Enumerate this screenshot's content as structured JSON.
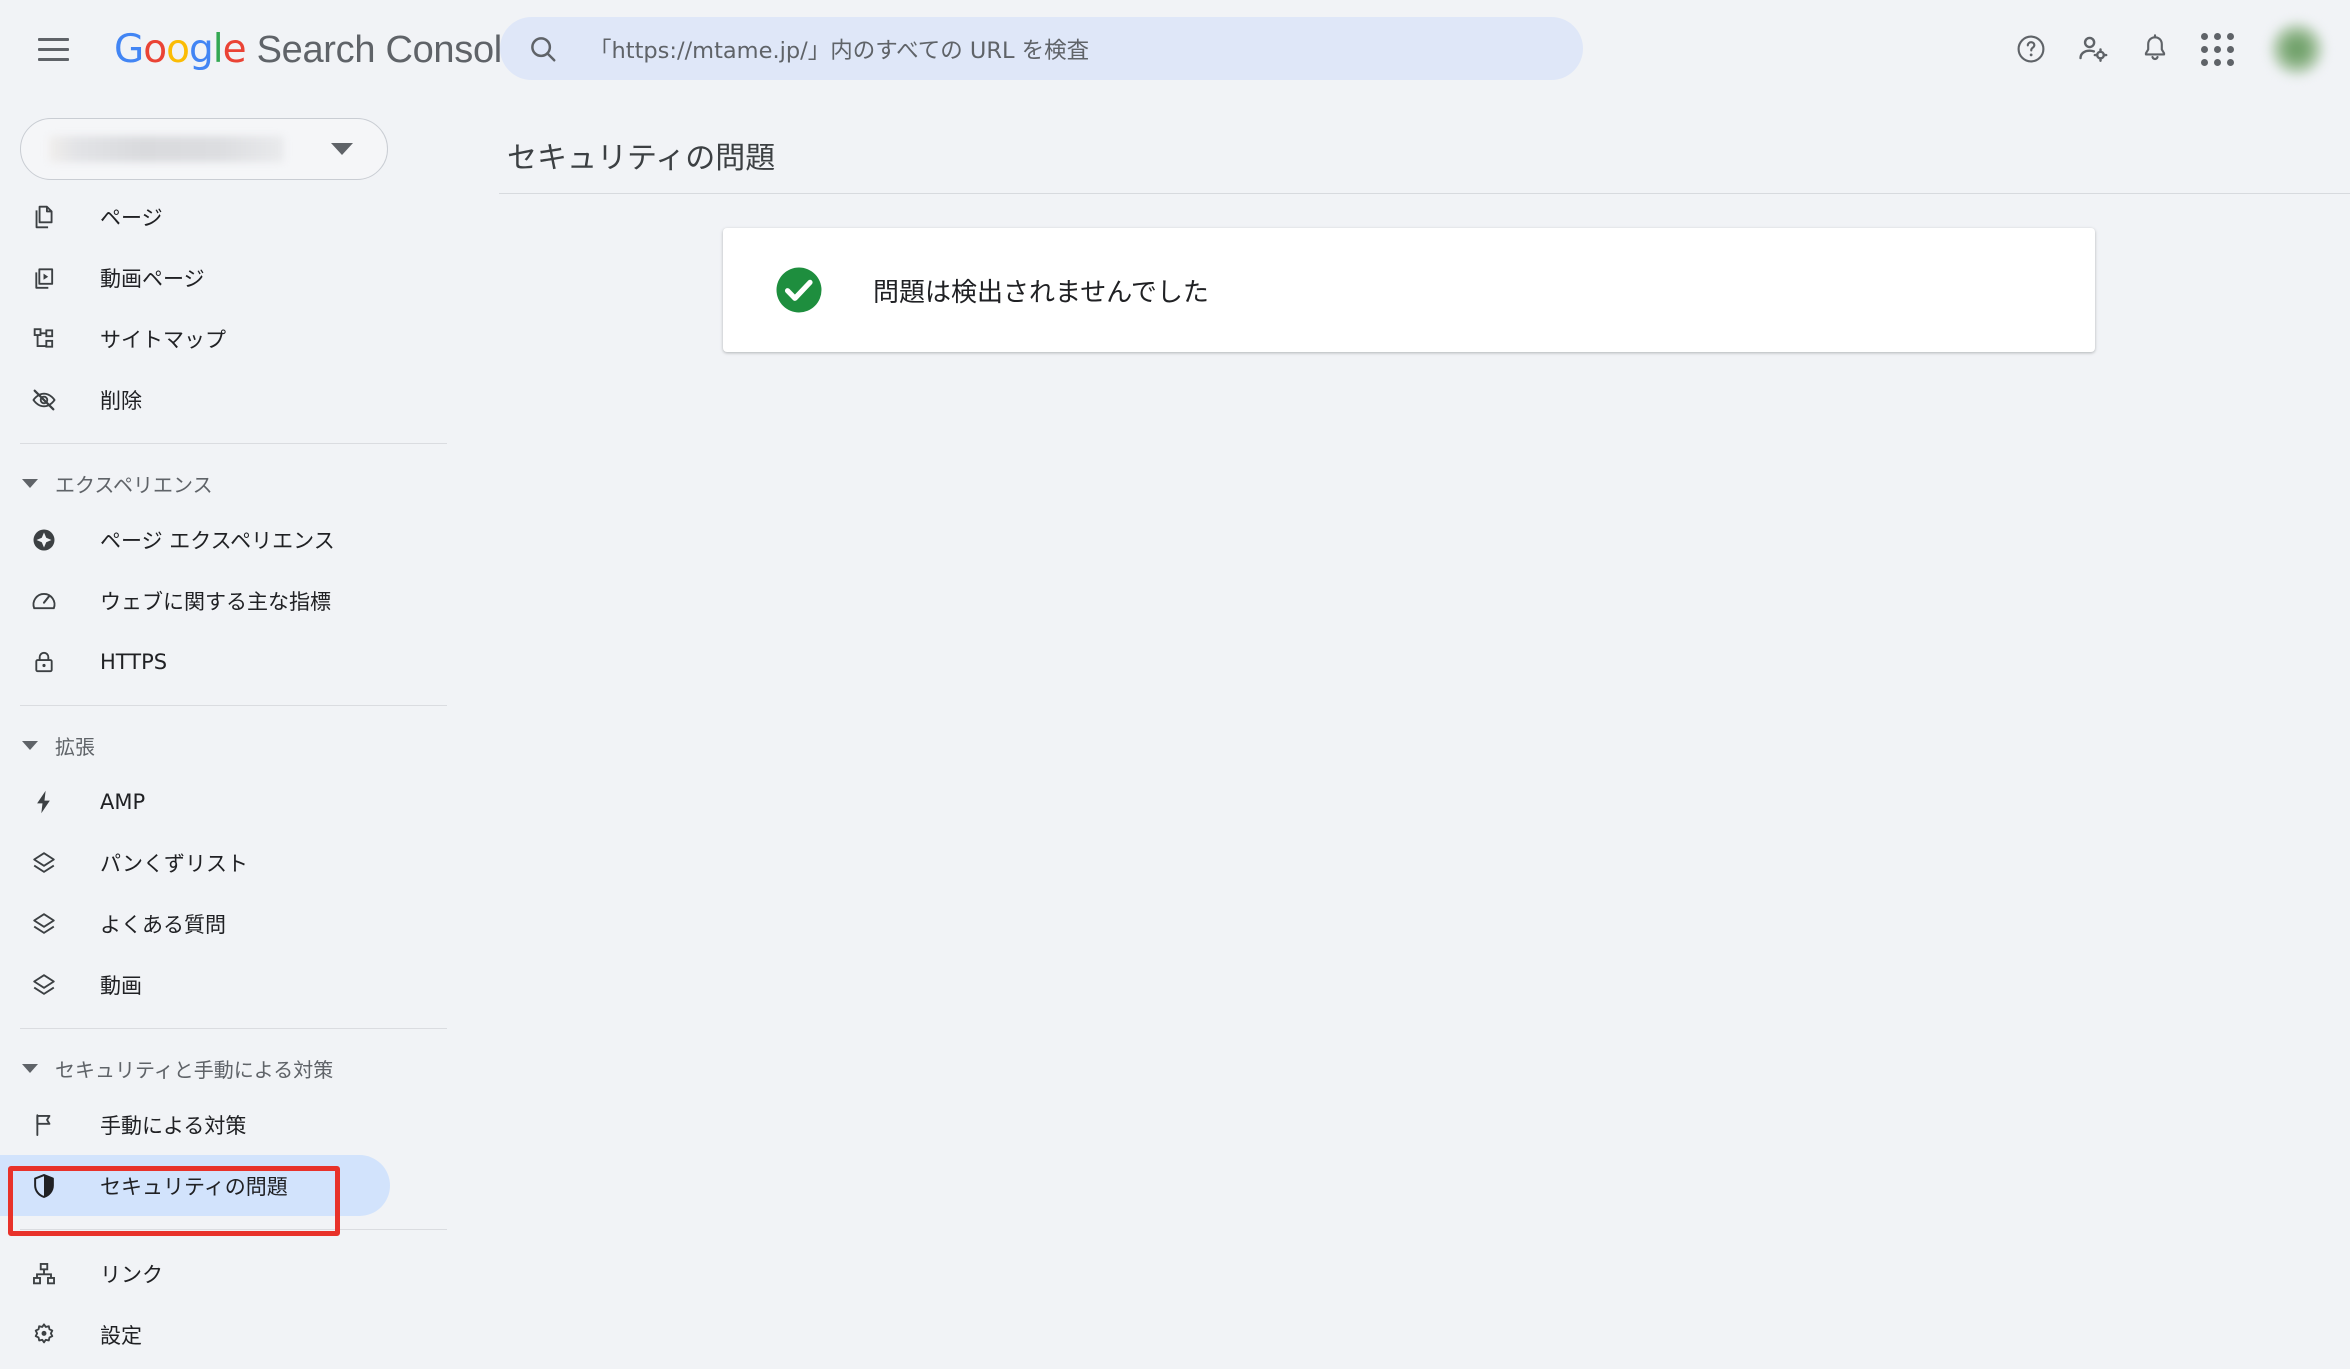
{
  "topbar": {
    "menu_icon": "hamburger-menu-icon",
    "logo_text": "Google",
    "product_name": "Search Console",
    "search": {
      "icon": "search-icon",
      "placeholder": "「https://mtame.jp/」内のすべての URL を検査",
      "value": ""
    },
    "actions": [
      {
        "name": "help-icon",
        "label": "ヘルプ"
      },
      {
        "name": "user-settings-icon",
        "label": "ユーザー設定"
      },
      {
        "name": "notifications-bell-icon",
        "label": "通知"
      },
      {
        "name": "google-apps-grid-icon",
        "label": "Google アプリ"
      }
    ],
    "avatar": {
      "name": "avatar",
      "label": ""
    }
  },
  "sidebar": {
    "property_selector": {
      "value": "",
      "caret_icon": "chevron-down-icon"
    },
    "groups": [
      {
        "id": "top",
        "header": null,
        "items": [
          {
            "id": "pages",
            "label": "ページ",
            "icon": "pages-icon",
            "selected": false
          },
          {
            "id": "video-pages",
            "label": "動画ページ",
            "icon": "video-page-icon",
            "selected": false
          },
          {
            "id": "sitemaps",
            "label": "サイトマップ",
            "icon": "sitemap-icon",
            "selected": false
          },
          {
            "id": "removals",
            "label": "削除",
            "icon": "eye-off-icon",
            "selected": false
          }
        ]
      },
      {
        "id": "experience",
        "header": {
          "label": "エクスペリエンス",
          "icon": "collapse-triangle-icon"
        },
        "items": [
          {
            "id": "page-experience",
            "label": "ページ エクスペリエンス",
            "icon": "page-experience-icon",
            "selected": false
          },
          {
            "id": "core-web-vitals",
            "label": "ウェブに関する主な指標",
            "icon": "speedometer-icon",
            "selected": false
          },
          {
            "id": "https",
            "label": "HTTPS",
            "icon": "lock-icon",
            "selected": false
          }
        ]
      },
      {
        "id": "enhancements",
        "header": {
          "label": "拡張",
          "icon": "collapse-triangle-icon"
        },
        "items": [
          {
            "id": "amp",
            "label": "AMP",
            "icon": "lightning-bolt-icon",
            "selected": false
          },
          {
            "id": "breadcrumbs",
            "label": "パンくずリスト",
            "icon": "layers-icon",
            "selected": false
          },
          {
            "id": "faq",
            "label": "よくある質問",
            "icon": "layers-icon",
            "selected": false
          },
          {
            "id": "videos",
            "label": "動画",
            "icon": "layers-icon",
            "selected": false
          }
        ]
      },
      {
        "id": "security",
        "header": {
          "label": "セキュリティと手動による対策",
          "icon": "collapse-triangle-icon"
        },
        "items": [
          {
            "id": "manual-actions",
            "label": "手動による対策",
            "icon": "flag-icon",
            "selected": false
          },
          {
            "id": "security-issues",
            "label": "セキュリティの問題",
            "icon": "shield-icon",
            "selected": true
          }
        ]
      },
      {
        "id": "bottom",
        "header": null,
        "items": [
          {
            "id": "links",
            "label": "リンク",
            "icon": "links-hierarchy-icon",
            "selected": false
          },
          {
            "id": "settings",
            "label": "設定",
            "icon": "gear-icon",
            "selected": false
          }
        ]
      }
    ]
  },
  "main": {
    "page_title": "セキュリティの問題",
    "status_card": {
      "icon": "check-circle-icon",
      "message": "問題は検出されませんでした"
    }
  },
  "annotation": {
    "name": "highlight-box",
    "target": "security-issues",
    "color": "#e8322a"
  },
  "colors": {
    "page_background": "#f1f3f6",
    "card_background": "#ffffff",
    "selected_nav_background": "#d2e3fc",
    "search_background": "#dfe7f8",
    "success_green": "#1e8e3e",
    "annotation_red": "#e8322a",
    "text_primary": "#202124",
    "text_secondary": "#5f6368"
  }
}
